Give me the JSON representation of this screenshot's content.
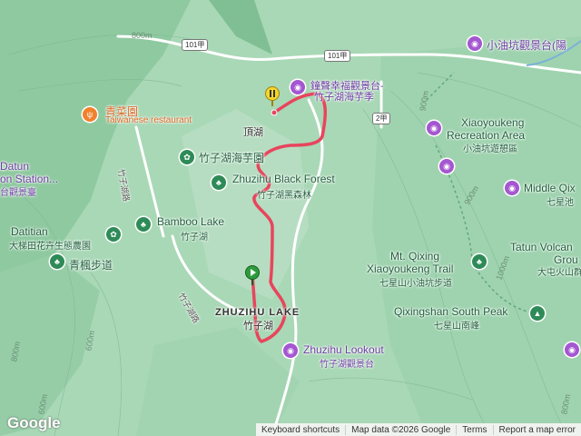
{
  "colors": {
    "route": "#e8455d",
    "terrain": "#a9d8b6",
    "poi_green": "#2e8b57",
    "poi_purple": "#a457d0",
    "poi_orange": "#f1812d"
  },
  "labels": {
    "xiaoyoukeng_obs": "小油坑觀景台(陽",
    "zhonggu": "鐘聲幸福觀景台-",
    "zhuzihu_sea_taro": "竹子湖海芋季",
    "dinghu": "頂湖",
    "qingcaiyuan": "青菜園",
    "taiwanese_restaurant": "Taiwanese restaurant",
    "datun_1": "Datun",
    "datun_2": "on Station...",
    "datun_3": "台觀景臺",
    "zhuzihu_haiyu": "竹子湖海芋園",
    "zhuzihu_black_forest": "Zhuzihu Black Forest",
    "black_forest_cjk": "竹子湖黑森林",
    "bamboo_lake": "Bamboo Lake",
    "bamboo_lake_cjk": "竹子湖",
    "datitian": "Datitian",
    "datitian_cjk": "大梯田花卉生態農園",
    "qingfeng": "青楓步道",
    "zhuzihu_lake": "ZHUZIHU LAKE",
    "zhuzihu_lake_cjk": "竹子湖",
    "lookout": "Zhuzihu Lookout",
    "lookout_cjk": "竹子湖觀景台",
    "xiaoyoukeng_rec_1": "Xiaoyoukeng",
    "xiaoyoukeng_rec_2": "Recreation Area",
    "xiaoyoukeng_rec_cjk": "小油坑遊憩區",
    "middle_qixing": "Middle Qix",
    "middle_qixing_cjk": "七星池",
    "mt_qixing_1": "Mt. Qixing",
    "mt_qixing_2": "Xiaoyoukeng Trail",
    "mt_qixing_cjk": "七星山小油坑步道",
    "tatun_1": "Tatun Volcan",
    "tatun_2": "Grou",
    "tatun_cjk": "大屯火山群",
    "qixingshan_south": "Qixingshan South Peak",
    "qixingshan_south_cjk": "七星山南峰",
    "zhuzi_road_1": "竹子湖路",
    "zhuzi_road_2": "竹子湖路"
  },
  "roads": {
    "r101a_1": "101甲",
    "r101a_2": "101甲",
    "r2a": "2甲"
  },
  "contours": [
    "800m",
    "800m",
    "900m",
    "900m",
    "600m",
    "1000m",
    "800m",
    "600m"
  ],
  "footer": {
    "shortcuts": "Keyboard shortcuts",
    "mapdata": "Map data ©2026 Google",
    "terms": "Terms",
    "report": "Report a map error"
  },
  "logo": "Google"
}
